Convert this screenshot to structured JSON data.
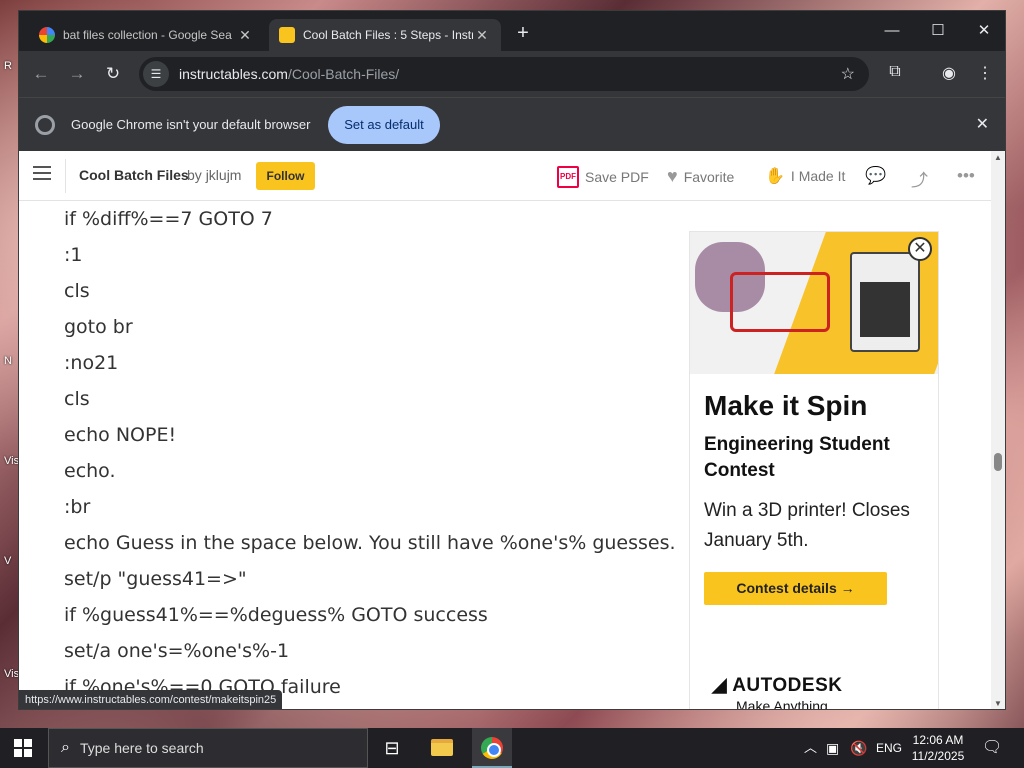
{
  "tabs": [
    {
      "title": "bat files collection - Google Sea",
      "active": false
    },
    {
      "title": "Cool Batch Files : 5 Steps - Instr",
      "active": true
    }
  ],
  "address": {
    "host": "instructables.com",
    "path": "/Cool-Batch-Files/"
  },
  "infobar": {
    "message": "Google Chrome isn't your default browser",
    "button": "Set as default"
  },
  "page_header": {
    "title": "Cool Batch Files",
    "by_label": "by",
    "author": "jklujm",
    "follow": "Follow",
    "save_pdf": "Save PDF",
    "pdf_badge": "PDF",
    "favorite": "Favorite",
    "made_it": "I Made It"
  },
  "code_lines": [
    "if %diff%==7 GOTO 7",
    ":1",
    "cls",
    "goto br",
    ":no21",
    "cls",
    "echo NOPE!",
    "echo.",
    ":br",
    "echo Guess in the space below. You still have %one's% guesses.",
    "set/p \"guess41=>\"",
    "if %guess41%==%deguess% GOTO success",
    "set/a one's=%one's%-1",
    "if %one's%==0 GOTO failure"
  ],
  "ad": {
    "headline": "Make it Spin",
    "subhead": "Engineering Student Contest",
    "body": "Win a 3D printer! Closes January 5th.",
    "cta": "Contest details →",
    "brand": "AUTODESK",
    "tagline": "Make Anything"
  },
  "status_url": "https://www.instructables.com/contest/makeitspin25",
  "taskbar": {
    "search_placeholder": "Type here to search",
    "language": "ENG",
    "time": "12:06 AM",
    "date": "11/2/2025"
  },
  "colors": {
    "follow": "#fac41f",
    "default_btn": "#a8c7fa",
    "chrome_dark": "#202124"
  }
}
